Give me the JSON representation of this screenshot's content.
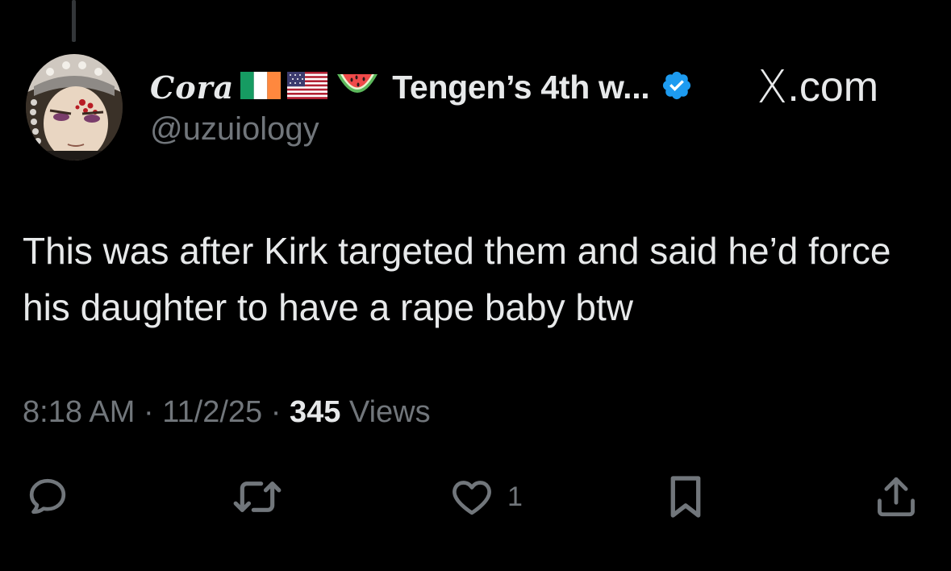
{
  "author": {
    "display_name": "Cora",
    "display_name_suffix": "Tengen’s 4th w...",
    "handle": "@uzuiology",
    "flags": [
      "ireland-flag",
      "usa-flag",
      "watermelon-emoji"
    ],
    "verified": true
  },
  "source": {
    "label_x": "X",
    "label_rest": ".com"
  },
  "tweet": {
    "text": "This was after Kirk targeted them and said he’d force his daughter to have a rape baby btw"
  },
  "meta": {
    "time": "8:18 AM",
    "sep1": "·",
    "date": "11/2/25",
    "sep2": "·",
    "views_count": "345",
    "views_label": "Views"
  },
  "actions": {
    "reply_icon": "reply-icon",
    "retweet_icon": "retweet-icon",
    "like_icon": "like-icon",
    "like_count": "1",
    "bookmark_icon": "bookmark-icon",
    "share_icon": "share-icon"
  },
  "colors": {
    "background": "#000000",
    "text_primary": "#e7e9ea",
    "text_secondary": "#71767b",
    "verified_blue": "#1d9bf0"
  }
}
